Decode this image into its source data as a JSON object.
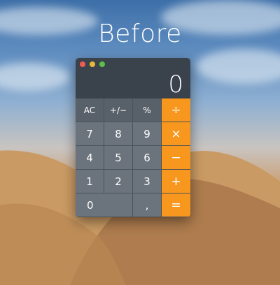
{
  "heading": "Before",
  "calculator": {
    "display": "0",
    "keys": {
      "ac": "AC",
      "sign": "+/−",
      "percent": "%",
      "divide": "÷",
      "seven": "7",
      "eight": "8",
      "nine": "9",
      "multiply": "×",
      "four": "4",
      "five": "5",
      "six": "6",
      "minus": "−",
      "one": "1",
      "two": "2",
      "three": "3",
      "plus": "+",
      "zero": "0",
      "decimal": ",",
      "equals": "="
    }
  },
  "colors": {
    "operator": "#f8971d",
    "function_key": "#58606a",
    "number_key": "#6b737c",
    "window": "#3a424c"
  }
}
